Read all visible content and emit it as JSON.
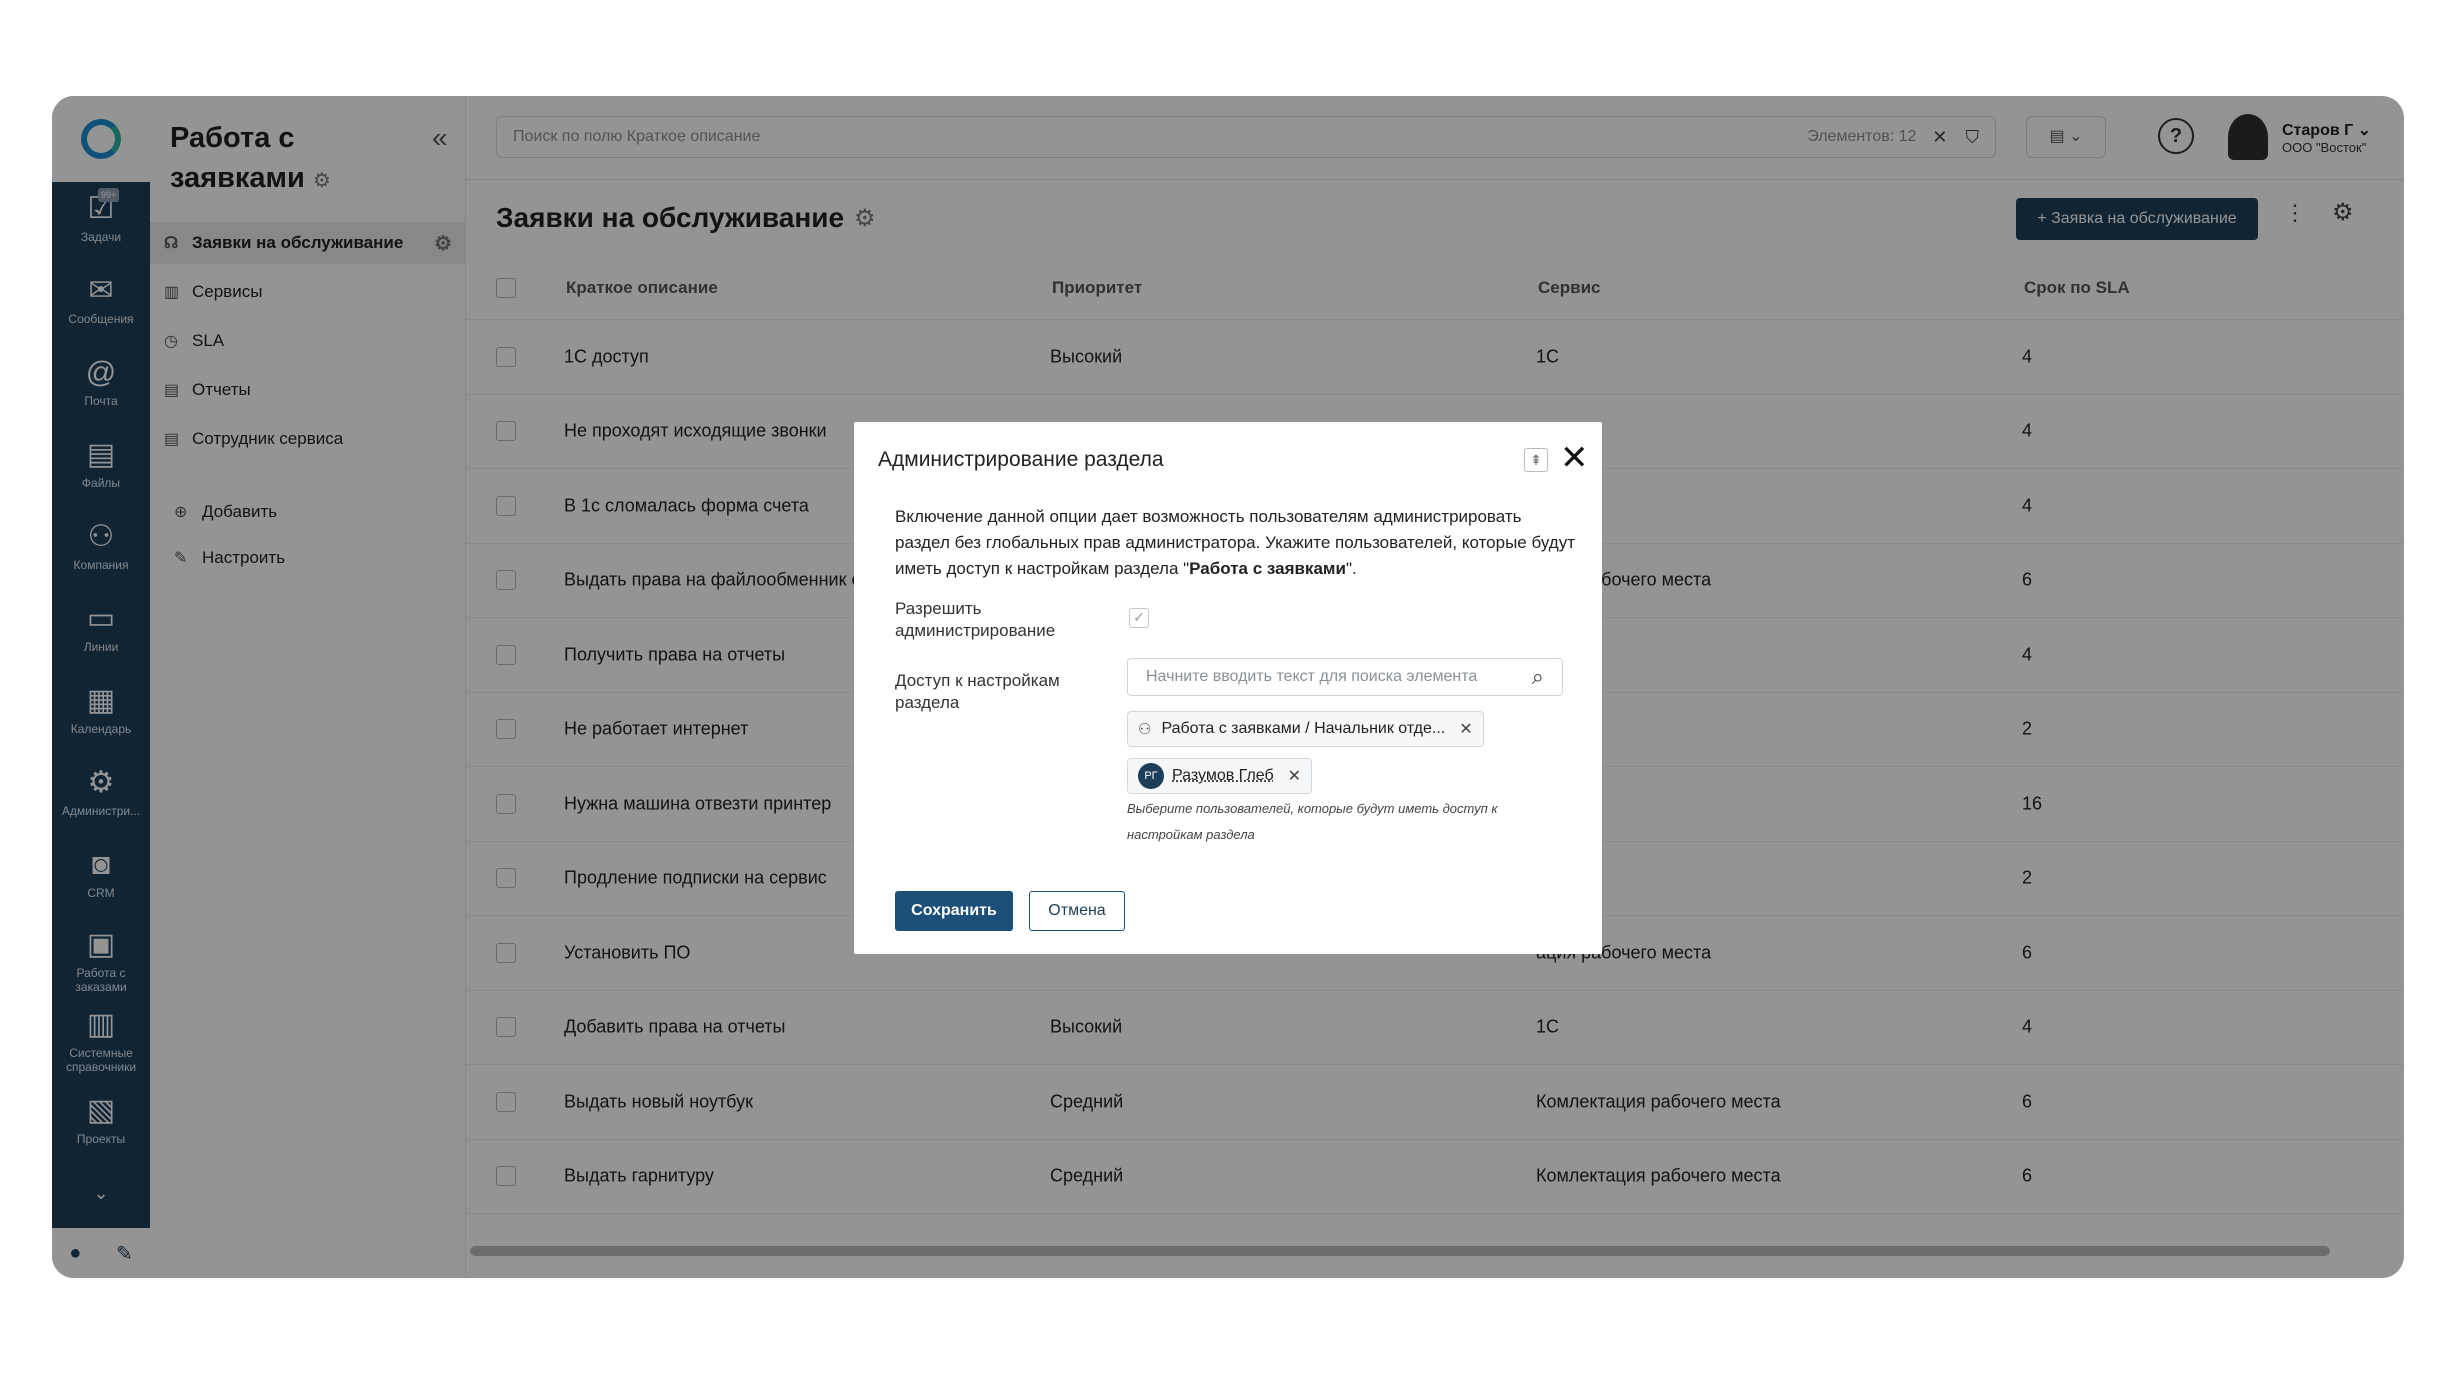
{
  "rail": {
    "badge": "99+",
    "items": [
      {
        "icon": "tasks-icon",
        "label": "Задачи"
      },
      {
        "icon": "messages-icon",
        "label": "Сообщения"
      },
      {
        "icon": "mail-icon",
        "label": "Почта"
      },
      {
        "icon": "files-icon",
        "label": "Файлы"
      },
      {
        "icon": "company-icon",
        "label": "Компания"
      },
      {
        "icon": "lines-icon",
        "label": "Линии"
      },
      {
        "icon": "calendar-icon",
        "label": "Календарь"
      },
      {
        "icon": "admin-icon",
        "label": "Администри..."
      },
      {
        "icon": "crm-icon",
        "label": "CRM"
      },
      {
        "icon": "orders-icon",
        "label": "Работа с заказами"
      },
      {
        "icon": "directories-icon",
        "label": "Системные справочники"
      },
      {
        "icon": "projects-icon",
        "label": "Проекты"
      }
    ]
  },
  "panel": {
    "title": "Работа с заявками",
    "nav": [
      {
        "label": "Заявки на обслуживание",
        "active": true
      },
      {
        "label": "Сервисы"
      },
      {
        "label": "SLA"
      },
      {
        "label": "Отчеты"
      },
      {
        "label": "Сотрудник сервиса"
      }
    ],
    "add_label": "Добавить",
    "configure_label": "Настроить"
  },
  "topbar": {
    "search_placeholder": "Поиск по полю Краткое описание",
    "elements_count": "Элементов: 12",
    "user_name": "Старов Г",
    "user_company": "ООО \"Восток\""
  },
  "page": {
    "title": "Заявки на обслуживание",
    "new_button": "+ Заявка на обслуживание"
  },
  "table": {
    "columns": [
      "Краткое описание",
      "Приоритет",
      "Сервис",
      "Срок по SLA"
    ],
    "rows": [
      [
        "1С доступ",
        "Высокий",
        "1С",
        "4"
      ],
      [
        "Не проходят исходящие звонки",
        "",
        "",
        "4"
      ],
      [
        "В 1с сломалась форма счета",
        "",
        "",
        "4"
      ],
      [
        "Выдать права на файлообменник cloud",
        "",
        "ация рабочего места",
        "6"
      ],
      [
        "Получить права на отчеты",
        "",
        "",
        "4"
      ],
      [
        "Не работает интернет",
        "",
        "т",
        "2"
      ],
      [
        "Нужна машина отвезти принтер",
        "",
        "ка",
        "16"
      ],
      [
        "Продление подписки на сервис",
        "",
        "т",
        "2"
      ],
      [
        "Установить ПО",
        "",
        "ация рабочего места",
        "6"
      ],
      [
        "Добавить права на отчеты",
        "Высокий",
        "1С",
        "4"
      ],
      [
        "Выдать новый ноутбук",
        "Средний",
        "Комлектация рабочего места",
        "6"
      ],
      [
        "Выдать гарнитуру",
        "Средний",
        "Комлектация рабочего места",
        "6"
      ]
    ]
  },
  "modal": {
    "title": "Администрирование раздела",
    "description_prefix": "Включение данной опции дает возможность пользователям администрировать раздел без глобальных прав администратора. Укажите пользователей, которые будут иметь доступ к настройкам раздела \"",
    "description_bold": "Работа с заявками",
    "description_suffix": "\".",
    "allow_label": "Разрешить администрирование",
    "access_label": "Доступ к настройкам раздела",
    "search_placeholder": "Начните вводить текст для поиска элемента",
    "tag_group": "Работа с заявками / Начальник отде...",
    "tag_user_initials": "РГ",
    "tag_user": "Разумов Глеб",
    "hint": "Выберите пользователей, которые будут иметь доступ к настройкам раздела",
    "save": "Сохранить",
    "cancel": "Отмена"
  }
}
